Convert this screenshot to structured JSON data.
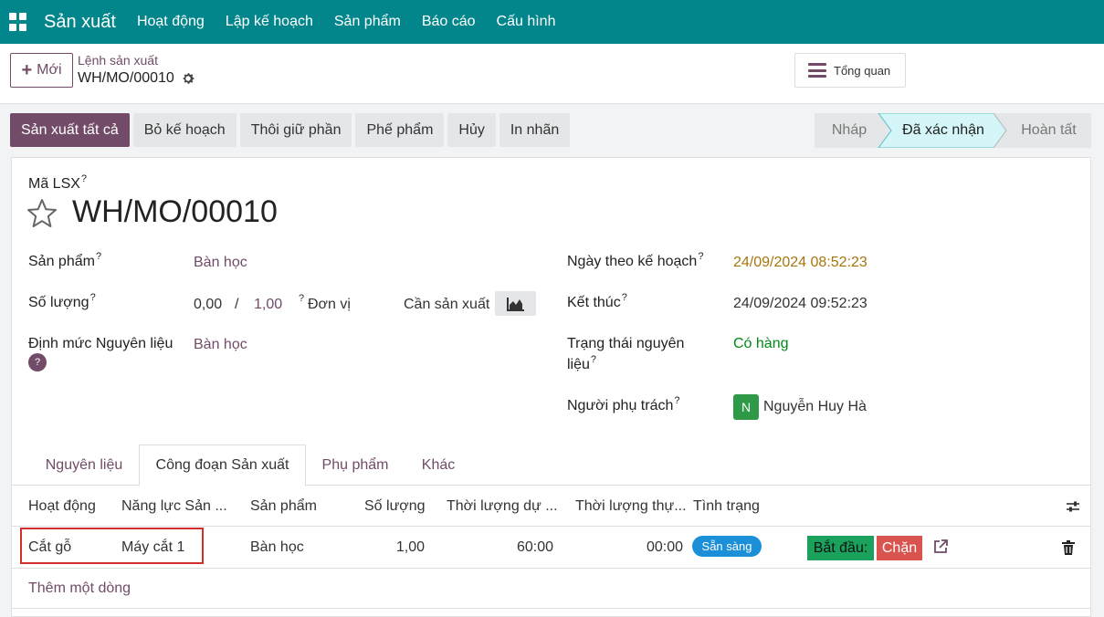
{
  "navbar": {
    "brand": "Sản xuất",
    "items": [
      "Hoạt động",
      "Lập kế hoạch",
      "Sản phẩm",
      "Báo cáo",
      "Cấu hình"
    ]
  },
  "control_panel": {
    "new_label": "Mới",
    "breadcrumb_parent": "Lệnh sản xuất",
    "breadcrumb_current": "WH/MO/00010",
    "overview_label": "Tổng quan"
  },
  "actions": [
    "Sản xuất tất cả",
    "Bỏ kế hoạch",
    "Thôi giữ phần",
    "Phế phẩm",
    "Hủy",
    "In nhãn"
  ],
  "status_stages": [
    "Nháp",
    "Đã xác nhận",
    "Hoàn tất"
  ],
  "status_active": "Đã xác nhận",
  "form": {
    "code_label": "Mã LSX",
    "title": "WH/MO/00010",
    "product_label": "Sản phẩm",
    "product_value": "Bàn học",
    "qty_label": "Số lượng",
    "qty_produced": "0,00",
    "qty_separator": "/",
    "qty_total": "1,00",
    "qty_uom": "Đơn vị",
    "qty_status": "Cần sản xuất",
    "bom_label": "Định mức Nguyên liệu",
    "bom_value": "Bàn học",
    "help_mark": "?",
    "planned_date_label": "Ngày theo kế hoạch",
    "planned_date_value": "24/09/2024 08:52:23",
    "end_label": "Kết thúc",
    "end_value": "24/09/2024 09:52:23",
    "component_status_label_1": "Trạng thái nguyên",
    "component_status_label_2": "liệu",
    "component_status_value": "Có hàng",
    "responsible_label": "Người phụ trách",
    "responsible_initial": "N",
    "responsible_name": "Nguyễn Huy Hà"
  },
  "tabs": [
    "Nguyên liệu",
    "Công đoạn Sản xuất",
    "Phụ phẩm",
    "Khác"
  ],
  "active_tab": "Công đoạn Sản xuất",
  "table": {
    "headers": [
      "Hoạt động",
      "Năng lực Sản ...",
      "Sản phẩm",
      "Số lượng",
      "Thời lượng dự ...",
      "Thời lượng thự...",
      "Tình trạng"
    ],
    "rows": [
      {
        "operation": "Cắt gỗ",
        "workcenter": "Máy cắt 1",
        "product": "Bàn học",
        "qty": "1,00",
        "expected_duration": "60:00",
        "real_duration": "00:00",
        "status": "Sẵn sàng",
        "start_label": "Bắt đầu:",
        "block_label": "Chặn"
      }
    ],
    "add_line": "Thêm một dòng"
  },
  "colors": {
    "navbar": "#02868c",
    "primary": "#714b67",
    "active_stage": "#d5f6f8",
    "ready_badge": "#1b8fd8",
    "start": "#1aa15b",
    "block": "#d9534f"
  }
}
